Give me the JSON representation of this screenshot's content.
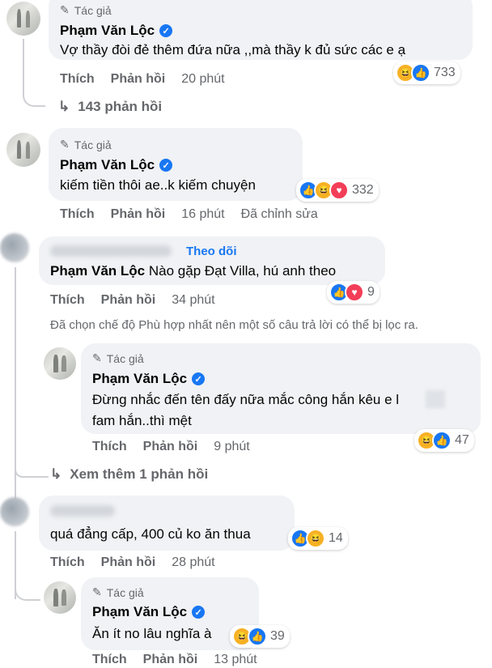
{
  "labels": {
    "author_tag": "Tác giả",
    "like": "Thích",
    "reply": "Phản hồi",
    "edited": "Đã chỉnh sửa",
    "follow": "Theo dõi"
  },
  "icons": {
    "author": "pencil-icon",
    "verified": "verified-badge-icon",
    "replies_arrow": "reply-arrow-icon",
    "reactions": [
      "haha-reaction-icon",
      "like-reaction-icon",
      "love-reaction-icon"
    ]
  },
  "colors": {
    "accent": "#1877f2",
    "bubble": "#f0f2f5",
    "meta": "#65676b"
  },
  "comments": [
    {
      "name": "Phạm Văn Lộc",
      "text": "Vợ thầy đòi đẻ thêm đứa nữa ,,mà thầy k đủ sức các e ạ",
      "time": "20 phút",
      "reactions": "733",
      "more_replies": "143 phản hồi"
    },
    {
      "name": "Phạm Văn Lộc",
      "text": "kiếm tiền thôi ae..k kiếm chuyện",
      "time": "16 phút",
      "reactions": "332"
    },
    {
      "mention": "Phạm Văn Lộc",
      "text": "Nào gặp Đạt Villa, hú anh theo",
      "time": "34 phút",
      "reactions": "9"
    },
    {
      "name": "Phạm Văn Lộc",
      "text_line1": "Đừng nhắc đến tên đấy nữa mắc công hắn kêu e l",
      "text_line2": "fam hắn..thì mệt",
      "time": "9 phút",
      "reactions": "47"
    },
    {
      "text": "quá đẳng cấp, 400 củ ko ăn thua",
      "time": "28 phút",
      "reactions": "14"
    },
    {
      "name": "Phạm Văn Lộc",
      "text": "Ăn ít no lâu nghĩa à",
      "time": "13 phút",
      "reactions": "39"
    }
  ],
  "filter_note": "Đã chọn chế độ Phù hợp nhất nên một số câu trả lời có thể bị lọc ra.",
  "view_more": "Xem thêm 1 phản hồi"
}
